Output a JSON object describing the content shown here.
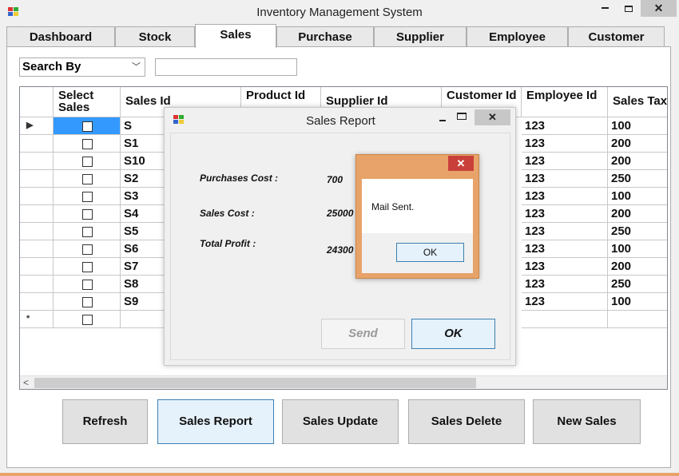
{
  "window": {
    "title": "Inventory Management System"
  },
  "tabs": [
    "Dashboard",
    "Stock",
    "Sales",
    "Purchase",
    "Supplier",
    "Employee",
    "Customer"
  ],
  "active_tab": "Sales",
  "search": {
    "by_label": "Search By",
    "value": ""
  },
  "grid": {
    "columns": [
      "Select Sales",
      "Sales Id",
      "Product Id",
      "Supplier Id",
      "Customer Id",
      "Employee Id",
      "Sales Tax"
    ],
    "rows": [
      {
        "sales_id": "S",
        "employee_id": "123",
        "sales_tax": "100"
      },
      {
        "sales_id": "S1",
        "employee_id": "123",
        "sales_tax": "200"
      },
      {
        "sales_id": "S10",
        "employee_id": "123",
        "sales_tax": "200"
      },
      {
        "sales_id": "S2",
        "employee_id": "123",
        "sales_tax": "250"
      },
      {
        "sales_id": "S3",
        "employee_id": "123",
        "sales_tax": "100"
      },
      {
        "sales_id": "S4",
        "employee_id": "123",
        "sales_tax": "200"
      },
      {
        "sales_id": "S5",
        "employee_id": "123",
        "sales_tax": "250"
      },
      {
        "sales_id": "S6",
        "employee_id": "123",
        "sales_tax": "100"
      },
      {
        "sales_id": "S7",
        "employee_id": "123",
        "sales_tax": "200"
      },
      {
        "sales_id": "S8",
        "employee_id": "123",
        "sales_tax": "250"
      },
      {
        "sales_id": "S9",
        "employee_id": "123",
        "sales_tax": "100"
      }
    ],
    "current_row_marker": "▶",
    "new_row_marker": "*"
  },
  "buttons": {
    "refresh": "Refresh",
    "sales_report": "Sales Report",
    "sales_update": "Sales Update",
    "sales_delete": "Sales Delete",
    "new_sales": "New Sales"
  },
  "report_dialog": {
    "title": "Sales Report",
    "purchases_cost_label": "Purchases Cost :",
    "purchases_cost_value": "700",
    "sales_cost_label": "Sales Cost :",
    "sales_cost_value": "25000",
    "total_profit_label": "Total Profit :",
    "total_profit_value": "24300",
    "send_label": "Send",
    "ok_label": "OK"
  },
  "message_box": {
    "text": "Mail Sent.",
    "ok_label": "OK"
  },
  "colors": {
    "message_frame": "#e8a36a",
    "close_red": "#c9403a",
    "focus_border": "#3c7fb1",
    "selection_blue": "#3399ff"
  }
}
